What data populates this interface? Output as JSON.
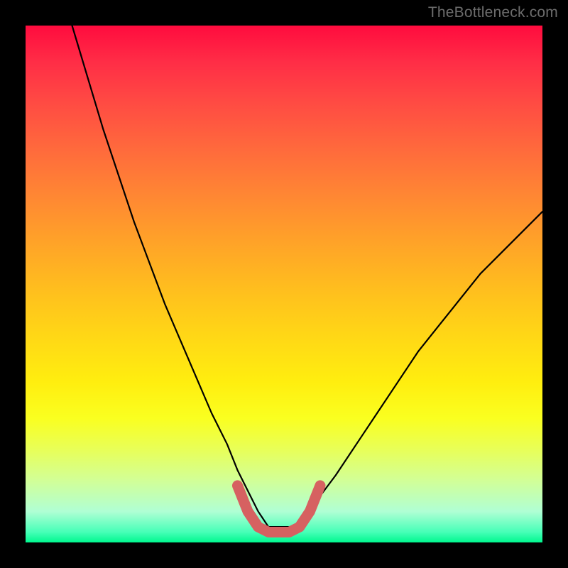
{
  "watermark": "TheBottleneck.com",
  "chart_data": {
    "type": "line",
    "title": "",
    "xlabel": "",
    "ylabel": "",
    "xlim": [
      0,
      100
    ],
    "ylim": [
      0,
      100
    ],
    "series": [
      {
        "name": "black-curve",
        "color": "#000000",
        "stroke_width": 2.2,
        "linecap": "round",
        "x": [
          9,
          12,
          15,
          18,
          21,
          24,
          27,
          30,
          33,
          36,
          39,
          41,
          43,
          45,
          47,
          53,
          55,
          57,
          60,
          64,
          68,
          72,
          76,
          80,
          84,
          88,
          92,
          96,
          100
        ],
        "y": [
          100,
          90,
          80,
          71,
          62,
          54,
          46,
          39,
          32,
          25,
          19,
          14,
          10,
          6,
          3,
          3,
          6,
          9,
          13,
          19,
          25,
          31,
          37,
          42,
          47,
          52,
          56,
          60,
          64
        ]
      },
      {
        "name": "red-highlight",
        "color": "#d66161",
        "stroke_width": 15,
        "linecap": "round",
        "x": [
          41,
          43,
          45,
          47,
          49,
          51,
          53,
          55,
          57
        ],
        "y": [
          11,
          6,
          3,
          2,
          2,
          2,
          3,
          6,
          11
        ]
      }
    ]
  }
}
